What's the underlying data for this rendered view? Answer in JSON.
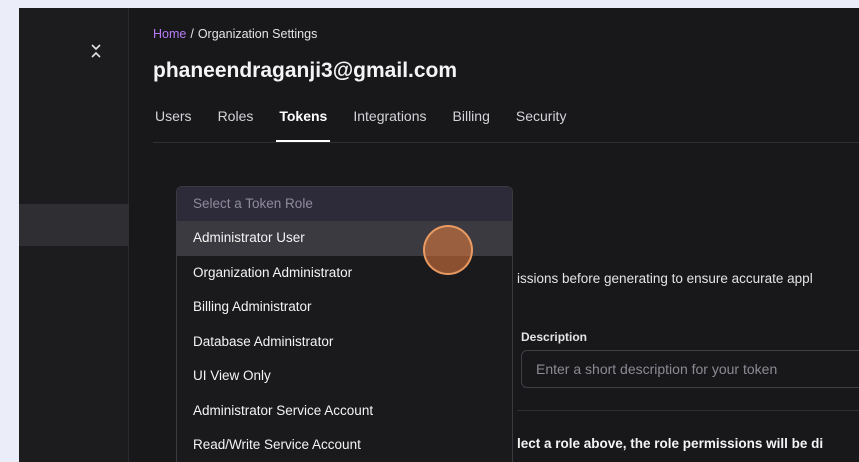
{
  "breadcrumb": {
    "home": "Home",
    "separator": "/",
    "current": "Organization Settings"
  },
  "page": {
    "title": "phaneendraganji3@gmail.com"
  },
  "tabs": [
    {
      "label": "Users"
    },
    {
      "label": "Roles"
    },
    {
      "label": "Tokens"
    },
    {
      "label": "Integrations"
    },
    {
      "label": "Billing"
    },
    {
      "label": "Security"
    }
  ],
  "active_tab": "Tokens",
  "form": {
    "info_text": "issions before generating to ensure accurate appl",
    "description_label": "Description",
    "description_placeholder": "Enter a short description for your token",
    "description_value": "",
    "bottom_text": "lect a role above, the role permissions will be di"
  },
  "role_dropdown": {
    "placeholder": "Select a Token Role",
    "options": [
      "Administrator User",
      "Organization Administrator",
      "Billing Administrator",
      "Database Administrator",
      "UI View Only",
      "Administrator Service Account",
      "Read/Write Service Account"
    ],
    "hovered_option": "Administrator User"
  },
  "icons": {
    "sidebar_collapse": "chevrons-collapse-icon"
  },
  "colors": {
    "accent_link": "#b77bf5",
    "background": "#18181b",
    "sidebar": "#1c1c1f",
    "cursor_highlight": "#e87e3e"
  }
}
